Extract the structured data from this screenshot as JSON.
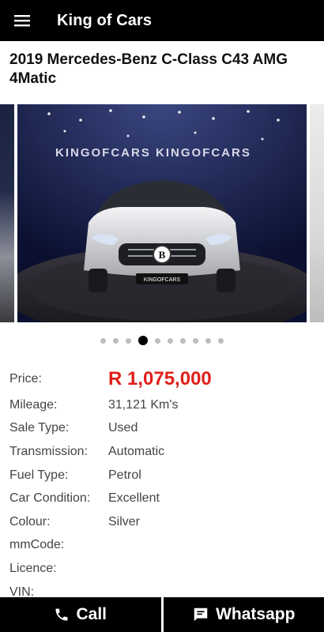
{
  "header": {
    "title": "King of Cars",
    "menu_icon": "hamburger-menu-icon"
  },
  "listing": {
    "title": "2019 Mercedes-Benz C-Class C43 AMG 4Matic",
    "gallery": {
      "slide_count": 10,
      "active_index": 3,
      "backdrop_text": "KINGOFCARS KINGOFCARS",
      "plate_text": "KINGOFCARS"
    },
    "specs": [
      {
        "label": "Price:",
        "value": "R 1,075,000"
      },
      {
        "label": "Mileage:",
        "value": "31,121 Km's"
      },
      {
        "label": "Sale Type:",
        "value": "Used"
      },
      {
        "label": "Transmission:",
        "value": "Automatic"
      },
      {
        "label": "Fuel Type:",
        "value": "Petrol"
      },
      {
        "label": "Car Condition:",
        "value": "Excellent"
      },
      {
        "label": "Colour:",
        "value": "Silver"
      },
      {
        "label": "mmCode:",
        "value": ""
      },
      {
        "label": "Licence:",
        "value": ""
      },
      {
        "label": "VIN:",
        "value": ""
      }
    ]
  },
  "actions": {
    "call_label": "Call",
    "whatsapp_label": "Whatsapp"
  },
  "colors": {
    "header_bg": "#000000",
    "price": "#e0201a",
    "active_dot": "#000000",
    "inactive_dot": "#bdbdbd"
  }
}
